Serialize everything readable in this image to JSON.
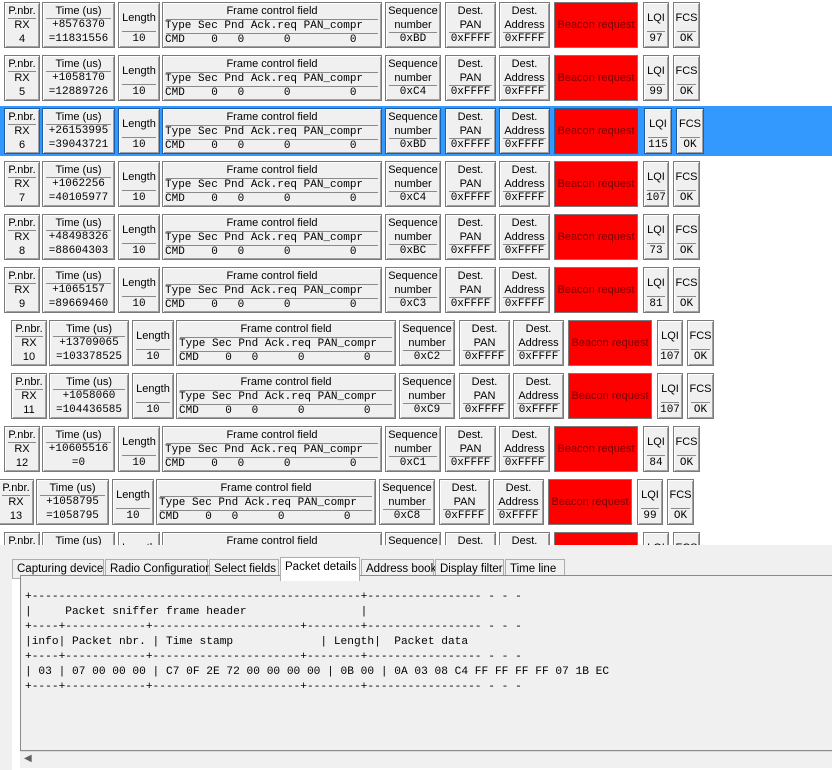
{
  "headers": {
    "pnbr": "P.nbr.",
    "rx": "RX",
    "time": "Time (us)",
    "length": "Length",
    "fcf": "Frame control field",
    "fcf_cols": "Type Sec Pnd Ack.req PAN_compr",
    "seq1": "Sequence",
    "seq2": "number",
    "pan1": "Dest.",
    "pan2": "PAN",
    "addr1": "Dest.",
    "addr2": "Address",
    "lqi": "LQI",
    "fcs": "FCS"
  },
  "packets": [
    {
      "nbr": "4",
      "time_delta": "+8576370",
      "time_abs": "=11831556",
      "length": "10",
      "fcf": "CMD    0   0      0         0",
      "seq": "0xBD",
      "pan": "0xFFFF",
      "addr": "0xFFFF",
      "payload": "Beacon request",
      "lqi": "97",
      "fcs": "OK"
    },
    {
      "nbr": "5",
      "time_delta": "+1058170",
      "time_abs": "=12889726",
      "length": "10",
      "fcf": "CMD    0   0      0         0",
      "seq": "0xC4",
      "pan": "0xFFFF",
      "addr": "0xFFFF",
      "payload": "Beacon request",
      "lqi": "99",
      "fcs": "OK"
    },
    {
      "nbr": "6",
      "time_delta": "+26153995",
      "time_abs": "=39043721",
      "length": "10",
      "fcf": "CMD    0   0      0         0",
      "seq": "0xBD",
      "pan": "0xFFFF",
      "addr": "0xFFFF",
      "payload": "Beacon request",
      "lqi": "115",
      "fcs": "OK",
      "selected": true
    },
    {
      "nbr": "7",
      "time_delta": "+1062256",
      "time_abs": "=40105977",
      "length": "10",
      "fcf": "CMD    0   0      0         0",
      "seq": "0xC4",
      "pan": "0xFFFF",
      "addr": "0xFFFF",
      "payload": "Beacon request",
      "lqi": "107",
      "fcs": "OK"
    },
    {
      "nbr": "8",
      "time_delta": "+48498326",
      "time_abs": "=88604303",
      "length": "10",
      "fcf": "CMD    0   0      0         0",
      "seq": "0xBC",
      "pan": "0xFFFF",
      "addr": "0xFFFF",
      "payload": "Beacon request",
      "lqi": "73",
      "fcs": "OK"
    },
    {
      "nbr": "9",
      "time_delta": "+1065157",
      "time_abs": "=89669460",
      "length": "10",
      "fcf": "CMD    0   0      0         0",
      "seq": "0xC3",
      "pan": "0xFFFF",
      "addr": "0xFFFF",
      "payload": "Beacon request",
      "lqi": "81",
      "fcs": "OK"
    },
    {
      "nbr": "10",
      "time_delta": "+13709065",
      "time_abs": "=103378525",
      "length": "10",
      "fcf": "CMD    0   0      0         0",
      "seq": "0xC2",
      "pan": "0xFFFF",
      "addr": "0xFFFF",
      "payload": "Beacon request",
      "lqi": "107",
      "fcs": "OK"
    },
    {
      "nbr": "11",
      "time_delta": "+1058060",
      "time_abs": "=104436585",
      "length": "10",
      "fcf": "CMD    0   0      0         0",
      "seq": "0xC9",
      "pan": "0xFFFF",
      "addr": "0xFFFF",
      "payload": "Beacon request",
      "lqi": "107",
      "fcs": "OK"
    },
    {
      "nbr": "12",
      "time_delta": "+10605516",
      "time_abs": "=0",
      "length": "10",
      "fcf": "CMD    0   0      0         0",
      "seq": "0xC1",
      "pan": "0xFFFF",
      "addr": "0xFFFF",
      "payload": "Beacon request",
      "lqi": "84",
      "fcs": "OK"
    },
    {
      "nbr": "13",
      "time_delta": "+1058795",
      "time_abs": "=1058795",
      "length": "10",
      "fcf": "CMD    0   0      0         0",
      "seq": "0xC8",
      "pan": "0xFFFF",
      "addr": "0xFFFF",
      "payload": "Beacon request",
      "lqi": "99",
      "fcs": "OK"
    },
    {
      "nbr": "",
      "time_delta": "",
      "time_abs": "",
      "length": "",
      "fcf": "",
      "seq": "",
      "pan": "",
      "addr": "",
      "payload": "",
      "lqi": "",
      "fcs": "",
      "partial": true
    }
  ],
  "tabs": [
    {
      "label": "Capturing device"
    },
    {
      "label": "Radio Configuration"
    },
    {
      "label": "Select fields"
    },
    {
      "label": "Packet details",
      "active": true
    },
    {
      "label": "Address book"
    },
    {
      "label": "Display filter"
    },
    {
      "label": "Time line"
    }
  ],
  "details": {
    "text": "+-------------------------------------------------+----------------- - - -\n|     Packet sniffer frame header                 |\n+----+------------+----------------------+--------+----------------- - - -\n|info| Packet nbr. | Time stamp             | Length|  Packet data\n+----+------------+----------------------+--------+----------------- - - -\n| 03 | 07 00 00 00 | C7 0F 2E 72 00 00 00 00 | 0B 00 | 0A 03 08 C4 FF FF FF FF 07 1B EC\n+----+------------+----------------------+--------+----------------- - - -"
  },
  "colors": {
    "selected_row": "#3399ff",
    "beacon_bg": "#ff0000"
  }
}
